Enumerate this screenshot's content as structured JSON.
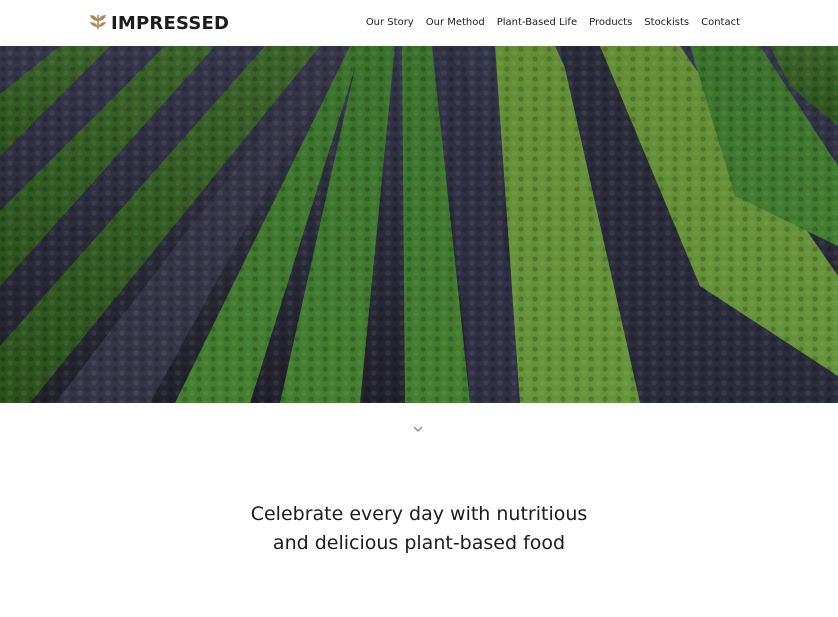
{
  "brand": {
    "name": "IMPRESSED",
    "logo_icon": "wheat-leaf-icon",
    "icon_color": "#a98a5c"
  },
  "nav": {
    "items": [
      {
        "label": "Our Story",
        "name": "nav-our-story"
      },
      {
        "label": "Our Method",
        "name": "nav-our-method"
      },
      {
        "label": "Plant-Based Life",
        "name": "nav-plant-based-life"
      },
      {
        "label": "Products",
        "name": "nav-products"
      },
      {
        "label": "Stockists",
        "name": "nav-stockists"
      },
      {
        "label": "Contact",
        "name": "nav-contact"
      }
    ]
  },
  "hero": {
    "scroll_icon": "chevron-down-icon"
  },
  "tagline": {
    "line1": "Celebrate every day with nutritious",
    "line2": "and delicious plant-based food"
  }
}
